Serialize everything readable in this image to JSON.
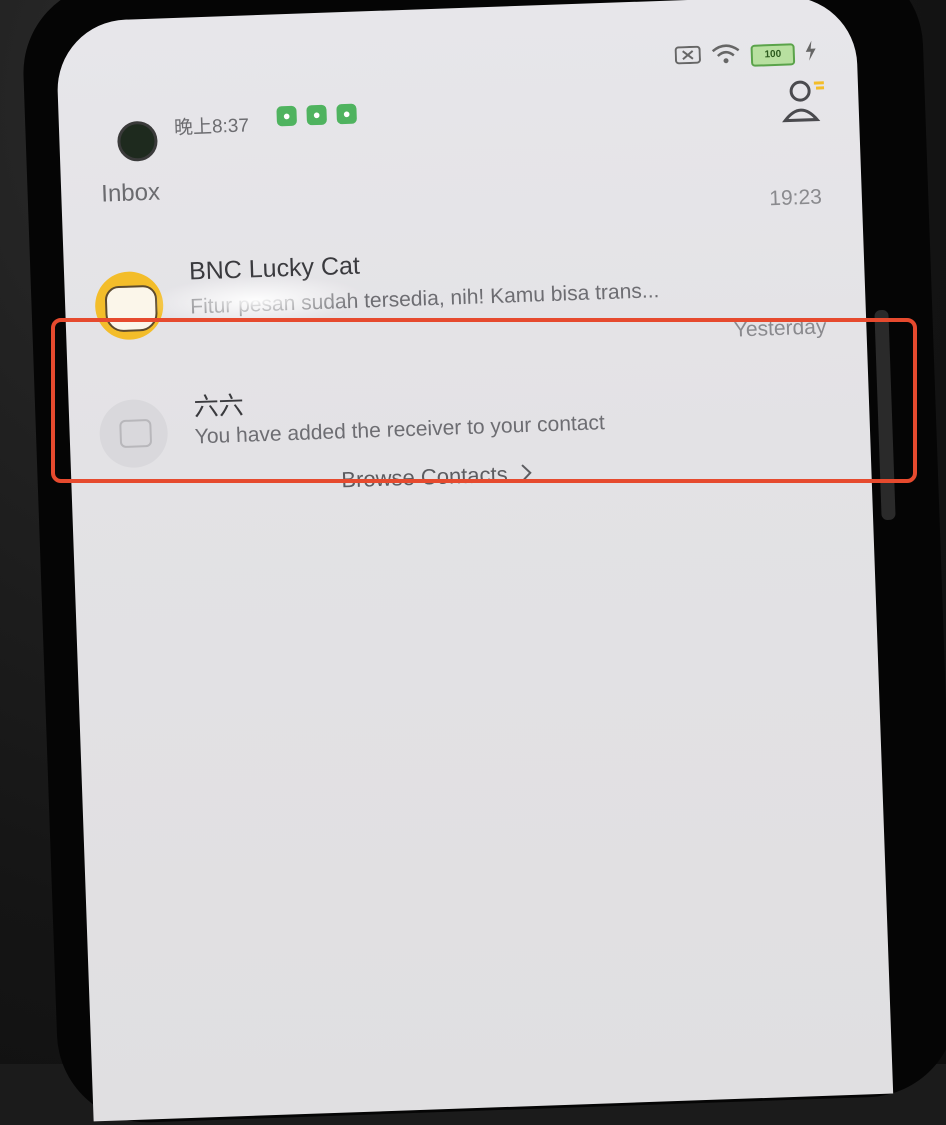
{
  "statusbar": {
    "time": "晚上8:37",
    "battery": "100",
    "icons": [
      "notification-app-icon",
      "wechat-icon",
      "wechat-icon",
      "sim-icon",
      "wifi-icon",
      "battery-icon",
      "charging-icon"
    ]
  },
  "header": {
    "title": "Inbox",
    "profile_icon": "profile-icon"
  },
  "inbox": {
    "items": [
      {
        "time": "19:23",
        "title": "BNC Lucky Cat",
        "preview": "Fitur pesan sudah tersedia, nih! Kamu bisa trans..."
      },
      {
        "time": "Yesterday",
        "title": "六六",
        "preview": "You have added the receiver to your contact"
      }
    ],
    "browse_label": "Browse Contacts",
    "browse_icon": "chevron-right-icon"
  },
  "colors": {
    "highlight": "#e64a2e",
    "accent_green": "#4fb35f",
    "avatar_yellow": "#f3bd2a"
  }
}
